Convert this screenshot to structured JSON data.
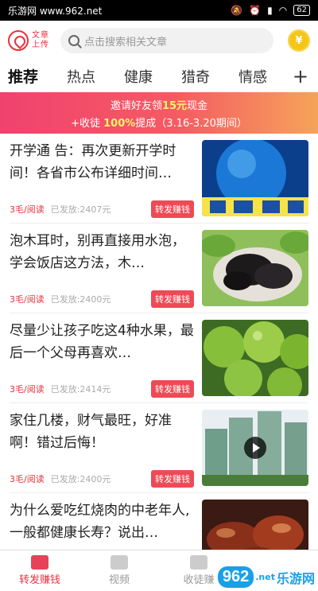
{
  "status_bar": {
    "site_label": "乐游网 www.962.net",
    "battery": "62"
  },
  "header": {
    "logo_line1": "文章",
    "logo_line2": "上传",
    "search_placeholder": "点击搜索相关文章",
    "coin_symbol": "¥"
  },
  "tabs": {
    "items": [
      "推荐",
      "热点",
      "健康",
      "猎奇",
      "情感"
    ],
    "add_symbol": "+"
  },
  "banner": {
    "line1_prefix": "邀请好友领",
    "line1_amount": "15元",
    "line1_suffix": "现金",
    "line2_prefix": "+收徒 ",
    "line2_rate": "100%",
    "line2_suffix": "提成（3.16-3.20期间）"
  },
  "articles": [
    {
      "title": "开学通 告：再次更新开学时间！各省市公布详细时间…",
      "rate": "3毛/阅读",
      "sent": "已发放:2407元",
      "action": "转发赚钱",
      "thumb": "globe",
      "video": false
    },
    {
      "title": "泡木耳时，别再直接用水泡，学会饭店这方法，木…",
      "rate": "3毛/阅读",
      "sent": "已发放:2400元",
      "action": "转发赚钱",
      "thumb": "fungus",
      "video": false
    },
    {
      "title": "尽量少让孩子吃这4种水果，最后一个父母再喜欢…",
      "rate": "3毛/阅读",
      "sent": "已发放:2414元",
      "action": "转发赚钱",
      "thumb": "fruit",
      "video": false
    },
    {
      "title": "家住几楼，财气最旺，好准啊！错过后悔！",
      "rate": "3毛/阅读",
      "sent": "已发放:2400元",
      "action": "转发赚钱",
      "thumb": "buildings",
      "video": true
    },
    {
      "title": "为什么爱吃红烧肉的中老年人,一般都健康长寿？说出…",
      "rate": "",
      "sent": "",
      "action": "",
      "thumb": "pork",
      "video": false
    }
  ],
  "bottom_nav": {
    "items": [
      "转发赚钱",
      "视频",
      "收徒赚"
    ]
  },
  "watermark": {
    "badge": "962",
    "suffix": ".net",
    "text": "乐游网"
  },
  "colors": {
    "accent": "#e8323c",
    "banner_start": "#f0426f",
    "banner_end": "#f6a35a",
    "coin": "#f5c518"
  }
}
